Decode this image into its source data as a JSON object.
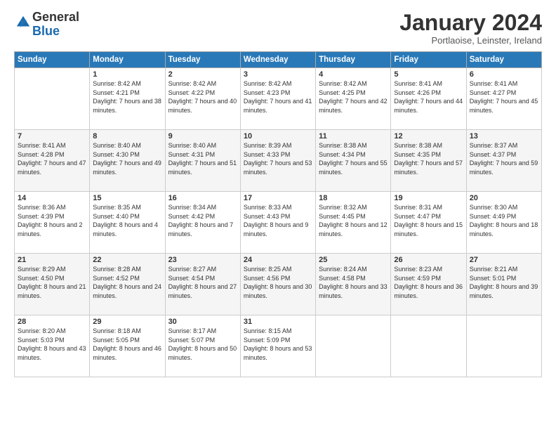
{
  "header": {
    "logo_general": "General",
    "logo_blue": "Blue",
    "month_title": "January 2024",
    "location": "Portlaoise, Leinster, Ireland"
  },
  "days_of_week": [
    "Sunday",
    "Monday",
    "Tuesday",
    "Wednesday",
    "Thursday",
    "Friday",
    "Saturday"
  ],
  "weeks": [
    [
      {
        "day": "",
        "sunrise": "",
        "sunset": "",
        "daylight": ""
      },
      {
        "day": "1",
        "sunrise": "Sunrise: 8:42 AM",
        "sunset": "Sunset: 4:21 PM",
        "daylight": "Daylight: 7 hours and 38 minutes."
      },
      {
        "day": "2",
        "sunrise": "Sunrise: 8:42 AM",
        "sunset": "Sunset: 4:22 PM",
        "daylight": "Daylight: 7 hours and 40 minutes."
      },
      {
        "day": "3",
        "sunrise": "Sunrise: 8:42 AM",
        "sunset": "Sunset: 4:23 PM",
        "daylight": "Daylight: 7 hours and 41 minutes."
      },
      {
        "day": "4",
        "sunrise": "Sunrise: 8:42 AM",
        "sunset": "Sunset: 4:25 PM",
        "daylight": "Daylight: 7 hours and 42 minutes."
      },
      {
        "day": "5",
        "sunrise": "Sunrise: 8:41 AM",
        "sunset": "Sunset: 4:26 PM",
        "daylight": "Daylight: 7 hours and 44 minutes."
      },
      {
        "day": "6",
        "sunrise": "Sunrise: 8:41 AM",
        "sunset": "Sunset: 4:27 PM",
        "daylight": "Daylight: 7 hours and 45 minutes."
      }
    ],
    [
      {
        "day": "7",
        "sunrise": "Sunrise: 8:41 AM",
        "sunset": "Sunset: 4:28 PM",
        "daylight": "Daylight: 7 hours and 47 minutes."
      },
      {
        "day": "8",
        "sunrise": "Sunrise: 8:40 AM",
        "sunset": "Sunset: 4:30 PM",
        "daylight": "Daylight: 7 hours and 49 minutes."
      },
      {
        "day": "9",
        "sunrise": "Sunrise: 8:40 AM",
        "sunset": "Sunset: 4:31 PM",
        "daylight": "Daylight: 7 hours and 51 minutes."
      },
      {
        "day": "10",
        "sunrise": "Sunrise: 8:39 AM",
        "sunset": "Sunset: 4:33 PM",
        "daylight": "Daylight: 7 hours and 53 minutes."
      },
      {
        "day": "11",
        "sunrise": "Sunrise: 8:38 AM",
        "sunset": "Sunset: 4:34 PM",
        "daylight": "Daylight: 7 hours and 55 minutes."
      },
      {
        "day": "12",
        "sunrise": "Sunrise: 8:38 AM",
        "sunset": "Sunset: 4:35 PM",
        "daylight": "Daylight: 7 hours and 57 minutes."
      },
      {
        "day": "13",
        "sunrise": "Sunrise: 8:37 AM",
        "sunset": "Sunset: 4:37 PM",
        "daylight": "Daylight: 7 hours and 59 minutes."
      }
    ],
    [
      {
        "day": "14",
        "sunrise": "Sunrise: 8:36 AM",
        "sunset": "Sunset: 4:39 PM",
        "daylight": "Daylight: 8 hours and 2 minutes."
      },
      {
        "day": "15",
        "sunrise": "Sunrise: 8:35 AM",
        "sunset": "Sunset: 4:40 PM",
        "daylight": "Daylight: 8 hours and 4 minutes."
      },
      {
        "day": "16",
        "sunrise": "Sunrise: 8:34 AM",
        "sunset": "Sunset: 4:42 PM",
        "daylight": "Daylight: 8 hours and 7 minutes."
      },
      {
        "day": "17",
        "sunrise": "Sunrise: 8:33 AM",
        "sunset": "Sunset: 4:43 PM",
        "daylight": "Daylight: 8 hours and 9 minutes."
      },
      {
        "day": "18",
        "sunrise": "Sunrise: 8:32 AM",
        "sunset": "Sunset: 4:45 PM",
        "daylight": "Daylight: 8 hours and 12 minutes."
      },
      {
        "day": "19",
        "sunrise": "Sunrise: 8:31 AM",
        "sunset": "Sunset: 4:47 PM",
        "daylight": "Daylight: 8 hours and 15 minutes."
      },
      {
        "day": "20",
        "sunrise": "Sunrise: 8:30 AM",
        "sunset": "Sunset: 4:49 PM",
        "daylight": "Daylight: 8 hours and 18 minutes."
      }
    ],
    [
      {
        "day": "21",
        "sunrise": "Sunrise: 8:29 AM",
        "sunset": "Sunset: 4:50 PM",
        "daylight": "Daylight: 8 hours and 21 minutes."
      },
      {
        "day": "22",
        "sunrise": "Sunrise: 8:28 AM",
        "sunset": "Sunset: 4:52 PM",
        "daylight": "Daylight: 8 hours and 24 minutes."
      },
      {
        "day": "23",
        "sunrise": "Sunrise: 8:27 AM",
        "sunset": "Sunset: 4:54 PM",
        "daylight": "Daylight: 8 hours and 27 minutes."
      },
      {
        "day": "24",
        "sunrise": "Sunrise: 8:25 AM",
        "sunset": "Sunset: 4:56 PM",
        "daylight": "Daylight: 8 hours and 30 minutes."
      },
      {
        "day": "25",
        "sunrise": "Sunrise: 8:24 AM",
        "sunset": "Sunset: 4:58 PM",
        "daylight": "Daylight: 8 hours and 33 minutes."
      },
      {
        "day": "26",
        "sunrise": "Sunrise: 8:23 AM",
        "sunset": "Sunset: 4:59 PM",
        "daylight": "Daylight: 8 hours and 36 minutes."
      },
      {
        "day": "27",
        "sunrise": "Sunrise: 8:21 AM",
        "sunset": "Sunset: 5:01 PM",
        "daylight": "Daylight: 8 hours and 39 minutes."
      }
    ],
    [
      {
        "day": "28",
        "sunrise": "Sunrise: 8:20 AM",
        "sunset": "Sunset: 5:03 PM",
        "daylight": "Daylight: 8 hours and 43 minutes."
      },
      {
        "day": "29",
        "sunrise": "Sunrise: 8:18 AM",
        "sunset": "Sunset: 5:05 PM",
        "daylight": "Daylight: 8 hours and 46 minutes."
      },
      {
        "day": "30",
        "sunrise": "Sunrise: 8:17 AM",
        "sunset": "Sunset: 5:07 PM",
        "daylight": "Daylight: 8 hours and 50 minutes."
      },
      {
        "day": "31",
        "sunrise": "Sunrise: 8:15 AM",
        "sunset": "Sunset: 5:09 PM",
        "daylight": "Daylight: 8 hours and 53 minutes."
      },
      {
        "day": "",
        "sunrise": "",
        "sunset": "",
        "daylight": ""
      },
      {
        "day": "",
        "sunrise": "",
        "sunset": "",
        "daylight": ""
      },
      {
        "day": "",
        "sunrise": "",
        "sunset": "",
        "daylight": ""
      }
    ]
  ]
}
